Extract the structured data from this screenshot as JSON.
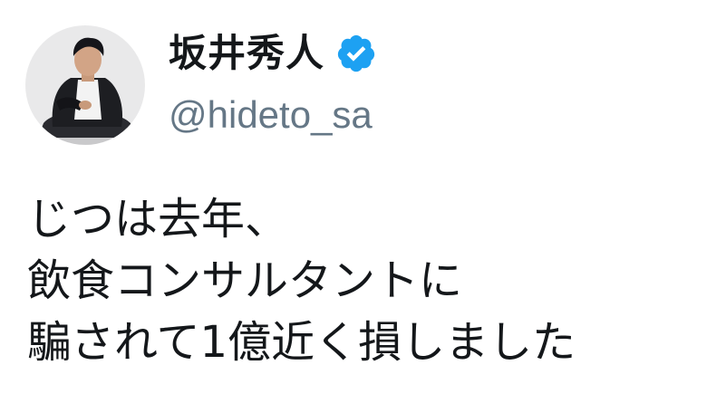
{
  "user": {
    "display_name": "坂井秀人",
    "handle": "@hideto_sa",
    "verified_icon": "verified-badge-icon",
    "verified_color": "#1da1f2",
    "avatar_icon": "avatar-photo"
  },
  "tweet": {
    "lines": [
      "じつは去年、",
      "飲食コンサルタントに",
      "騙されて1億近く損しました"
    ]
  },
  "colors": {
    "text": "#14171a",
    "handle": "#657786",
    "background": "#ffffff"
  }
}
